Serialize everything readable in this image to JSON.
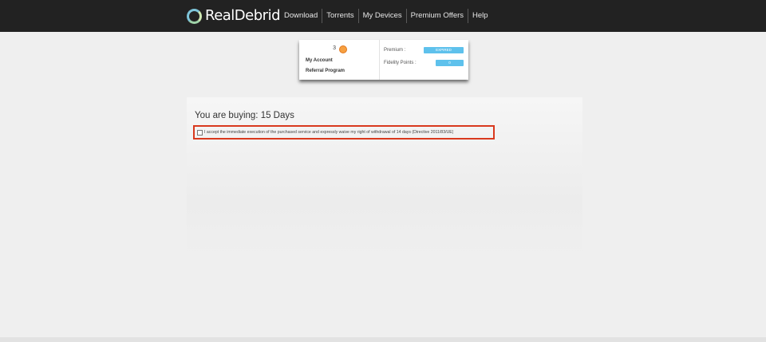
{
  "header": {
    "logo_text": "RealDebrid",
    "nav": [
      {
        "label": "Download"
      },
      {
        "label": "Torrents"
      },
      {
        "label": "My Devices"
      },
      {
        "label": "Premium Offers"
      },
      {
        "label": "Help"
      }
    ]
  },
  "account": {
    "username_suffix": "3",
    "my_account_label": "My Account",
    "referral_label": "Referral Program",
    "premium_label": "Premium :",
    "premium_status": "EXPIRED",
    "fidelity_label": "Fidelity Points :",
    "fidelity_value": "0"
  },
  "purchase": {
    "title": "You are buying: 15 Days",
    "consent_text": "I accept the immediate execution of the purchased service and expressly waive my right of withdrawal of 14 days (Directive 2011/83/UE)",
    "consent_checked": false
  },
  "colors": {
    "header_bg": "#222222",
    "badge_blue": "#5ec1ec",
    "highlight_red": "#d9391e"
  }
}
